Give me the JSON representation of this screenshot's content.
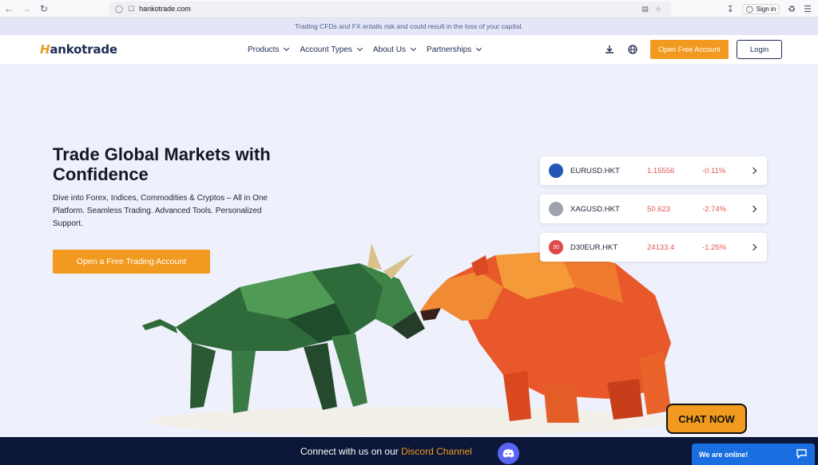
{
  "browser": {
    "url": "hankotrade.com",
    "sign_in": "Sign in"
  },
  "risk_banner": "Trading CFDs and FX entails risk and could result in the loss of your capital.",
  "header": {
    "logo_first": "H",
    "logo_rest": "ankotrade",
    "nav": [
      {
        "label": "Products"
      },
      {
        "label": "Account Types"
      },
      {
        "label": "About Us"
      },
      {
        "label": "Partnerships"
      }
    ],
    "open_account": "Open Free Account",
    "login": "Login"
  },
  "hero": {
    "title": "Trade Global Markets with Confidence",
    "subtitle": "Dive into Forex, Indices, Commodities & Cryptos – All in One Platform. Seamless Trading. Advanced Tools. Personalized Support.",
    "cta": "Open a Free Trading Account"
  },
  "quotes": [
    {
      "symbol": "EURUSD.HKT",
      "price": "1.15556",
      "change": "-0.11%",
      "icon": "eu-us-flag-icon",
      "color": "#2456b8",
      "badge": ""
    },
    {
      "symbol": "XAGUSD.HKT",
      "price": "50.623",
      "change": "-2.74%",
      "icon": "silver-coin-icon",
      "color": "#9ea3ad",
      "badge": ""
    },
    {
      "symbol": "D30EUR.HKT",
      "price": "24133.4",
      "change": "-1.25%",
      "icon": "de30-index-icon",
      "color": "#e04848",
      "badge": "30"
    }
  ],
  "discord": {
    "prefix": "Connect with us on our ",
    "highlight": "Discord Channel"
  },
  "chat": {
    "bubble": "CHAT NOW",
    "widget": "We are online!"
  },
  "colors": {
    "accent": "#f29a1f",
    "navy": "#1f2a55",
    "negative": "#e25555",
    "discord_bar": "#0c1638",
    "chat_blue": "#1a6fe0"
  }
}
